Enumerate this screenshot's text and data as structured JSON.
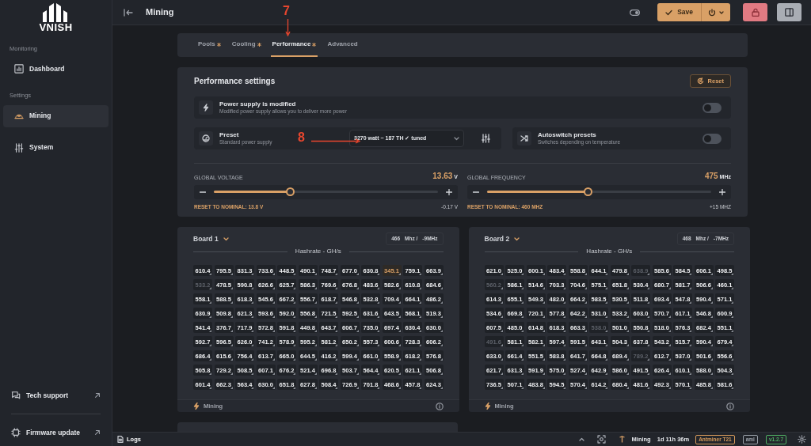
{
  "sidebar": {
    "logo": "VNISH",
    "sections": [
      {
        "label": "Monitoring",
        "items": [
          {
            "label": "Dashboard",
            "kind": "chart",
            "selected": false
          }
        ]
      },
      {
        "label": "Settings",
        "items": [
          {
            "label": "Mining",
            "kind": "helmet",
            "selected": true
          },
          {
            "label": "System",
            "kind": "sliders",
            "selected": false
          }
        ]
      }
    ],
    "bottom_links": [
      {
        "label": "Tech support",
        "kind": "chat"
      },
      {
        "label": "Firmware update",
        "kind": "chip"
      }
    ]
  },
  "header": {
    "title": "Mining",
    "save": "Save"
  },
  "tabs": [
    {
      "label": "Pools",
      "modified": true,
      "selected": false
    },
    {
      "label": "Cooling",
      "modified": true,
      "selected": false
    },
    {
      "label": "Performance",
      "modified": true,
      "selected": true
    },
    {
      "label": "Advanced",
      "modified": false,
      "selected": false
    }
  ],
  "performance": {
    "title": "Performance settings",
    "reset": "Reset",
    "power_supply": {
      "title": "Power supply is modified",
      "subtitle": "Modified power supply allows you to deliver more power",
      "on": false
    },
    "preset": {
      "title": "Preset",
      "subtitle": "Standard power supply",
      "value": "3270 watt ~ 187 TH ✓ tuned"
    },
    "autoswitch": {
      "title": "Autoswitch presets",
      "subtitle": "Switches depending on temperature",
      "on": false
    },
    "sliders": [
      {
        "label": "GLOBAL VOLTAGE",
        "value": "13.63",
        "unit": "V",
        "level": 0.34,
        "reset": "RESET TO NOMINAL: 13.8 V",
        "delta": "-0.17 V"
      },
      {
        "label": "GLOBAL FREQUENCY",
        "value": "475",
        "unit": "MHz",
        "level": 0.45,
        "reset": "RESET TO NOMINAL: 460 MHZ",
        "delta": "+15 MHZ"
      }
    ]
  },
  "boards": [
    {
      "title": "Board 1",
      "frequency": "466",
      "frequency_unit": "Mhz /",
      "offset": "-9MHz",
      "chart_title": "Hashrate - GH/s",
      "status": "Mining",
      "rows": [
        [
          {
            "value": "610.4",
            "kind": "normal"
          },
          {
            "value": "795.5",
            "kind": "normal"
          },
          {
            "value": "831.3",
            "kind": "normal"
          },
          {
            "value": "733.6",
            "kind": "normal"
          },
          {
            "value": "448.5",
            "kind": "normal"
          },
          {
            "value": "490.1",
            "kind": "normal"
          },
          {
            "value": "748.7",
            "kind": "normal"
          },
          {
            "value": "677.0",
            "kind": "normal"
          },
          {
            "value": "630.8",
            "kind": "normal"
          },
          {
            "value": "345.1",
            "kind": "warn"
          },
          {
            "value": "759.1",
            "kind": "normal"
          },
          {
            "value": "663.9",
            "kind": "normal"
          }
        ],
        [
          {
            "value": "533.2",
            "kind": "dim"
          },
          {
            "value": "478.5",
            "kind": "normal"
          },
          {
            "value": "590.8",
            "kind": "normal"
          },
          {
            "value": "626.6",
            "kind": "normal"
          },
          {
            "value": "625.7",
            "kind": "normal"
          },
          {
            "value": "586.3",
            "kind": "normal"
          },
          {
            "value": "769.6",
            "kind": "normal"
          },
          {
            "value": "676.8",
            "kind": "normal"
          },
          {
            "value": "483.6",
            "kind": "normal"
          },
          {
            "value": "582.6",
            "kind": "normal"
          },
          {
            "value": "610.8",
            "kind": "normal"
          },
          {
            "value": "684.6",
            "kind": "normal"
          }
        ],
        [
          {
            "value": "558.1",
            "kind": "normal"
          },
          {
            "value": "588.5",
            "kind": "normal"
          },
          {
            "value": "618.3",
            "kind": "normal"
          },
          {
            "value": "545.6",
            "kind": "normal"
          },
          {
            "value": "667.2",
            "kind": "normal"
          },
          {
            "value": "556.7",
            "kind": "normal"
          },
          {
            "value": "618.7",
            "kind": "normal"
          },
          {
            "value": "546.8",
            "kind": "normal"
          },
          {
            "value": "532.8",
            "kind": "normal"
          },
          {
            "value": "709.4",
            "kind": "normal"
          },
          {
            "value": "664.1",
            "kind": "normal"
          },
          {
            "value": "486.2",
            "kind": "normal"
          }
        ],
        [
          {
            "value": "630.9",
            "kind": "normal"
          },
          {
            "value": "509.8",
            "kind": "normal"
          },
          {
            "value": "621.3",
            "kind": "normal"
          },
          {
            "value": "593.6",
            "kind": "normal"
          },
          {
            "value": "592.0",
            "kind": "normal"
          },
          {
            "value": "556.8",
            "kind": "normal"
          },
          {
            "value": "721.5",
            "kind": "normal"
          },
          {
            "value": "592.5",
            "kind": "normal"
          },
          {
            "value": "631.6",
            "kind": "normal"
          },
          {
            "value": "643.5",
            "kind": "normal"
          },
          {
            "value": "568.1",
            "kind": "normal"
          },
          {
            "value": "519.3",
            "kind": "normal"
          }
        ],
        [
          {
            "value": "541.4",
            "kind": "normal"
          },
          {
            "value": "376.7",
            "kind": "normal"
          },
          {
            "value": "717.9",
            "kind": "normal"
          },
          {
            "value": "572.8",
            "kind": "normal"
          },
          {
            "value": "591.8",
            "kind": "normal"
          },
          {
            "value": "449.8",
            "kind": "normal"
          },
          {
            "value": "643.7",
            "kind": "normal"
          },
          {
            "value": "606.7",
            "kind": "normal"
          },
          {
            "value": "735.0",
            "kind": "normal"
          },
          {
            "value": "697.4",
            "kind": "normal"
          },
          {
            "value": "630.4",
            "kind": "normal"
          },
          {
            "value": "630.0",
            "kind": "normal"
          }
        ],
        [
          {
            "value": "592.7",
            "kind": "normal"
          },
          {
            "value": "596.5",
            "kind": "normal"
          },
          {
            "value": "626.0",
            "kind": "normal"
          },
          {
            "value": "741.2",
            "kind": "normal"
          },
          {
            "value": "578.9",
            "kind": "normal"
          },
          {
            "value": "595.2",
            "kind": "normal"
          },
          {
            "value": "581.2",
            "kind": "normal"
          },
          {
            "value": "650.2",
            "kind": "normal"
          },
          {
            "value": "557.3",
            "kind": "normal"
          },
          {
            "value": "600.6",
            "kind": "normal"
          },
          {
            "value": "728.3",
            "kind": "normal"
          },
          {
            "value": "606.2",
            "kind": "normal"
          }
        ],
        [
          {
            "value": "686.4",
            "kind": "normal"
          },
          {
            "value": "615.6",
            "kind": "normal"
          },
          {
            "value": "756.4",
            "kind": "normal"
          },
          {
            "value": "613.7",
            "kind": "normal"
          },
          {
            "value": "665.0",
            "kind": "normal"
          },
          {
            "value": "644.5",
            "kind": "normal"
          },
          {
            "value": "416.2",
            "kind": "normal"
          },
          {
            "value": "599.4",
            "kind": "normal"
          },
          {
            "value": "661.0",
            "kind": "normal"
          },
          {
            "value": "558.9",
            "kind": "normal"
          },
          {
            "value": "618.2",
            "kind": "normal"
          },
          {
            "value": "576.8",
            "kind": "normal"
          }
        ],
        [
          {
            "value": "505.8",
            "kind": "normal"
          },
          {
            "value": "729.2",
            "kind": "normal"
          },
          {
            "value": "508.5",
            "kind": "normal"
          },
          {
            "value": "607.1",
            "kind": "normal"
          },
          {
            "value": "676.2",
            "kind": "normal"
          },
          {
            "value": "521.4",
            "kind": "normal"
          },
          {
            "value": "696.8",
            "kind": "normal"
          },
          {
            "value": "503.7",
            "kind": "normal"
          },
          {
            "value": "564.4",
            "kind": "normal"
          },
          {
            "value": "620.5",
            "kind": "normal"
          },
          {
            "value": "621.1",
            "kind": "normal"
          },
          {
            "value": "506.8",
            "kind": "normal"
          }
        ],
        [
          {
            "value": "601.4",
            "kind": "normal"
          },
          {
            "value": "662.3",
            "kind": "normal"
          },
          {
            "value": "563.4",
            "kind": "normal"
          },
          {
            "value": "630.0",
            "kind": "normal"
          },
          {
            "value": "651.8",
            "kind": "normal"
          },
          {
            "value": "627.8",
            "kind": "normal"
          },
          {
            "value": "508.4",
            "kind": "normal"
          },
          {
            "value": "726.9",
            "kind": "normal"
          },
          {
            "value": "701.8",
            "kind": "normal"
          },
          {
            "value": "468.6",
            "kind": "normal"
          },
          {
            "value": "457.8",
            "kind": "normal"
          },
          {
            "value": "624.3",
            "kind": "normal"
          }
        ]
      ]
    },
    {
      "title": "Board 2",
      "frequency": "468",
      "frequency_unit": "Mhz /",
      "offset": "-7MHz",
      "chart_title": "Hashrate - GH/s",
      "status": "Mining",
      "rows": [
        [
          {
            "value": "621.0",
            "kind": "normal"
          },
          {
            "value": "525.0",
            "kind": "normal"
          },
          {
            "value": "600.1",
            "kind": "normal"
          },
          {
            "value": "483.4",
            "kind": "normal"
          },
          {
            "value": "558.8",
            "kind": "normal"
          },
          {
            "value": "644.1",
            "kind": "normal"
          },
          {
            "value": "479.8",
            "kind": "normal"
          },
          {
            "value": "638.9",
            "kind": "dim"
          },
          {
            "value": "585.6",
            "kind": "normal"
          },
          {
            "value": "584.5",
            "kind": "normal"
          },
          {
            "value": "606.1",
            "kind": "normal"
          },
          {
            "value": "498.5",
            "kind": "normal"
          }
        ],
        [
          {
            "value": "560.2",
            "kind": "dim"
          },
          {
            "value": "586.1",
            "kind": "normal"
          },
          {
            "value": "514.6",
            "kind": "normal"
          },
          {
            "value": "703.3",
            "kind": "normal"
          },
          {
            "value": "704.6",
            "kind": "normal"
          },
          {
            "value": "575.1",
            "kind": "normal"
          },
          {
            "value": "651.8",
            "kind": "normal"
          },
          {
            "value": "530.4",
            "kind": "normal"
          },
          {
            "value": "680.7",
            "kind": "normal"
          },
          {
            "value": "581.7",
            "kind": "normal"
          },
          {
            "value": "506.6",
            "kind": "normal"
          },
          {
            "value": "460.1",
            "kind": "normal"
          }
        ],
        [
          {
            "value": "614.3",
            "kind": "normal"
          },
          {
            "value": "655.1",
            "kind": "normal"
          },
          {
            "value": "549.3",
            "kind": "normal"
          },
          {
            "value": "482.0",
            "kind": "normal"
          },
          {
            "value": "664.2",
            "kind": "normal"
          },
          {
            "value": "583.5",
            "kind": "normal"
          },
          {
            "value": "530.5",
            "kind": "normal"
          },
          {
            "value": "511.8",
            "kind": "normal"
          },
          {
            "value": "693.4",
            "kind": "normal"
          },
          {
            "value": "547.8",
            "kind": "normal"
          },
          {
            "value": "590.4",
            "kind": "normal"
          },
          {
            "value": "571.1",
            "kind": "normal"
          }
        ],
        [
          {
            "value": "534.6",
            "kind": "normal"
          },
          {
            "value": "669.8",
            "kind": "normal"
          },
          {
            "value": "720.1",
            "kind": "normal"
          },
          {
            "value": "577.8",
            "kind": "normal"
          },
          {
            "value": "642.2",
            "kind": "normal"
          },
          {
            "value": "531.0",
            "kind": "normal"
          },
          {
            "value": "533.2",
            "kind": "normal"
          },
          {
            "value": "603.0",
            "kind": "normal"
          },
          {
            "value": "570.7",
            "kind": "normal"
          },
          {
            "value": "617.1",
            "kind": "normal"
          },
          {
            "value": "546.8",
            "kind": "normal"
          },
          {
            "value": "600.9",
            "kind": "normal"
          }
        ],
        [
          {
            "value": "607.5",
            "kind": "normal"
          },
          {
            "value": "485.0",
            "kind": "normal"
          },
          {
            "value": "614.8",
            "kind": "normal"
          },
          {
            "value": "618.3",
            "kind": "normal"
          },
          {
            "value": "663.3",
            "kind": "normal"
          },
          {
            "value": "538.0",
            "kind": "dim"
          },
          {
            "value": "501.0",
            "kind": "normal"
          },
          {
            "value": "550.8",
            "kind": "normal"
          },
          {
            "value": "518.0",
            "kind": "normal"
          },
          {
            "value": "576.3",
            "kind": "normal"
          },
          {
            "value": "682.4",
            "kind": "normal"
          },
          {
            "value": "551.1",
            "kind": "normal"
          }
        ],
        [
          {
            "value": "491.6",
            "kind": "dim"
          },
          {
            "value": "581.1",
            "kind": "normal"
          },
          {
            "value": "582.1",
            "kind": "normal"
          },
          {
            "value": "597.4",
            "kind": "normal"
          },
          {
            "value": "591.5",
            "kind": "normal"
          },
          {
            "value": "643.1",
            "kind": "normal"
          },
          {
            "value": "504.3",
            "kind": "normal"
          },
          {
            "value": "637.8",
            "kind": "normal"
          },
          {
            "value": "543.2",
            "kind": "normal"
          },
          {
            "value": "515.7",
            "kind": "normal"
          },
          {
            "value": "590.4",
            "kind": "normal"
          },
          {
            "value": "679.4",
            "kind": "normal"
          }
        ],
        [
          {
            "value": "633.0",
            "kind": "normal"
          },
          {
            "value": "661.4",
            "kind": "normal"
          },
          {
            "value": "551.5",
            "kind": "normal"
          },
          {
            "value": "583.8",
            "kind": "normal"
          },
          {
            "value": "641.7",
            "kind": "normal"
          },
          {
            "value": "664.8",
            "kind": "normal"
          },
          {
            "value": "689.4",
            "kind": "normal"
          },
          {
            "value": "789.2",
            "kind": "dim"
          },
          {
            "value": "612.7",
            "kind": "normal"
          },
          {
            "value": "537.0",
            "kind": "normal"
          },
          {
            "value": "501.6",
            "kind": "normal"
          },
          {
            "value": "556.6",
            "kind": "normal"
          }
        ],
        [
          {
            "value": "621.7",
            "kind": "normal"
          },
          {
            "value": "631.3",
            "kind": "normal"
          },
          {
            "value": "591.9",
            "kind": "normal"
          },
          {
            "value": "575.0",
            "kind": "normal"
          },
          {
            "value": "527.4",
            "kind": "normal"
          },
          {
            "value": "642.9",
            "kind": "normal"
          },
          {
            "value": "586.0",
            "kind": "normal"
          },
          {
            "value": "491.5",
            "kind": "normal"
          },
          {
            "value": "626.4",
            "kind": "normal"
          },
          {
            "value": "610.1",
            "kind": "normal"
          },
          {
            "value": "588.0",
            "kind": "normal"
          },
          {
            "value": "504.3",
            "kind": "normal"
          }
        ],
        [
          {
            "value": "736.5",
            "kind": "normal"
          },
          {
            "value": "507.1",
            "kind": "normal"
          },
          {
            "value": "483.8",
            "kind": "normal"
          },
          {
            "value": "594.5",
            "kind": "normal"
          },
          {
            "value": "570.4",
            "kind": "normal"
          },
          {
            "value": "614.2",
            "kind": "normal"
          },
          {
            "value": "680.4",
            "kind": "normal"
          },
          {
            "value": "481.6",
            "kind": "normal"
          },
          {
            "value": "492.3",
            "kind": "normal"
          },
          {
            "value": "570.1",
            "kind": "normal"
          },
          {
            "value": "485.8",
            "kind": "normal"
          },
          {
            "value": "581.6",
            "kind": "normal"
          }
        ]
      ]
    }
  ],
  "annotations": [
    {
      "label": "7",
      "kind": "down"
    },
    {
      "label": "8",
      "kind": "right"
    }
  ],
  "status_bar": {
    "logs": "Logs",
    "state": "Mining",
    "uptime": "1d 11h 36m",
    "badges": [
      {
        "label": "Antminer T21",
        "color": "#d69a5a"
      },
      {
        "label": "aml",
        "color": "#9aa0a8"
      },
      {
        "label": "v1.2.7",
        "color": "#4fae62"
      }
    ]
  }
}
